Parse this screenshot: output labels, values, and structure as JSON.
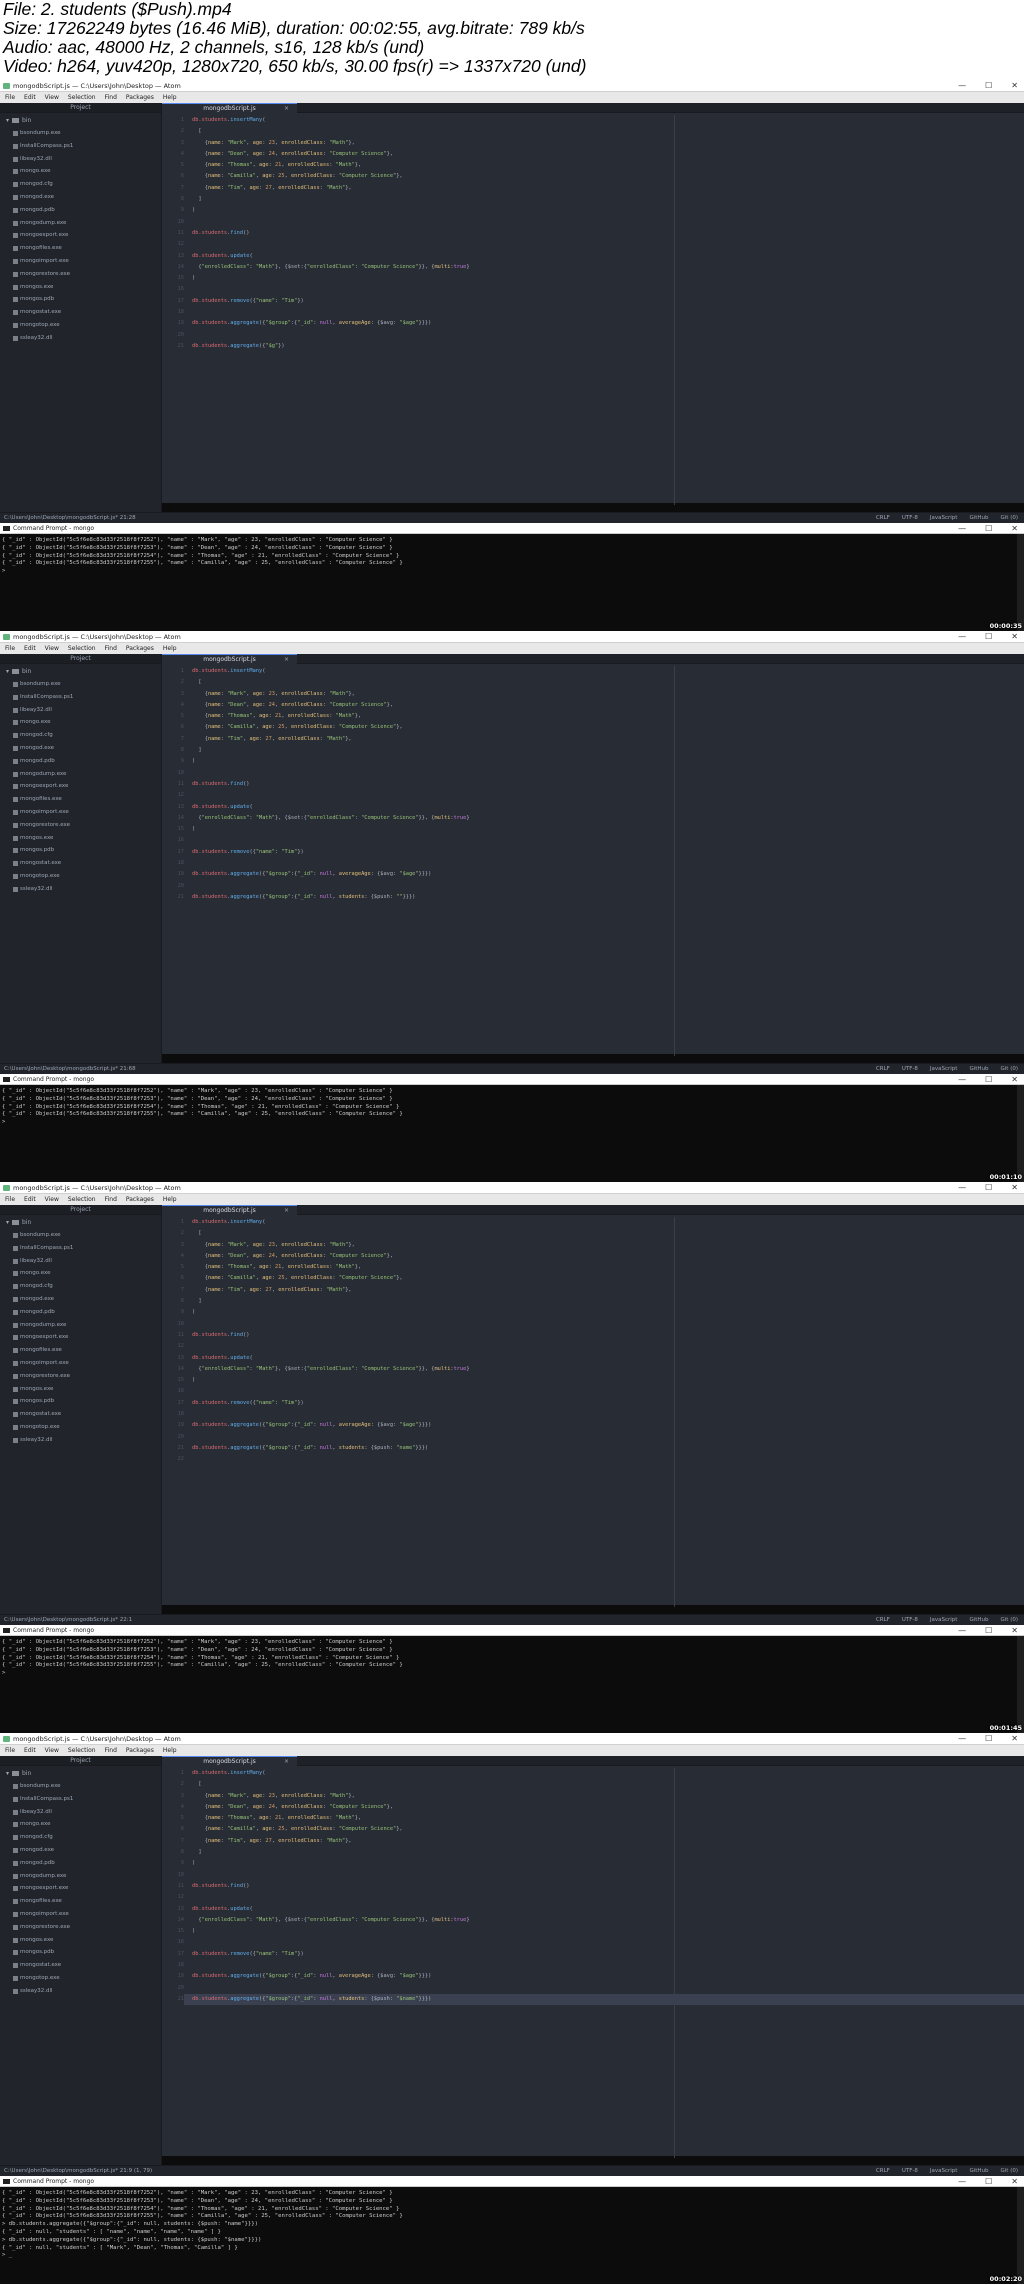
{
  "header": {
    "lines": [
      "File: 2. students ($Push).mp4",
      "Size: 17262249 bytes (16.46 MiB), duration: 00:02:55, avg.bitrate: 789 kb/s",
      "Audio: aac, 48000 Hz, 2 channels, s16, 128 kb/s (und)",
      "Video: h264, yuv420p, 1280x720, 650 kb/s, 30.00 fps(r) => 1337x720 (und)"
    ]
  },
  "app": {
    "window_title": "mongodbScript.js — C:\\Users\\John\\Desktop — Atom",
    "menus": [
      "File",
      "Edit",
      "View",
      "Selection",
      "Find",
      "Packages",
      "Help"
    ],
    "project_label": "Project",
    "root_folder": "bin",
    "files": [
      "bsondump.exe",
      "InstallCompass.ps1",
      "libeay32.dll",
      "mongo.exe",
      "mongod.cfg",
      "mongod.exe",
      "mongod.pdb",
      "mongodump.exe",
      "mongoexport.exe",
      "mongofiles.exe",
      "mongoimport.exe",
      "mongorestore.exe",
      "mongos.exe",
      "mongos.pdb",
      "mongostat.exe",
      "mongotop.exe",
      "ssleay32.dll"
    ],
    "tab_label": "mongodbScript.js",
    "tab_close": "×",
    "status_right": [
      "CRLF",
      "UTF-8",
      "JavaScript",
      "GitHub",
      "Git (0)"
    ],
    "cmd_title": "Command Prompt - mongo",
    "window_buttons": [
      "—",
      "☐",
      "✕"
    ]
  },
  "frames": [
    {
      "status_left": "C:\\Users\\John\\Desktop\\mongodbScript.js*  21:28",
      "timestamp": "00:00:35",
      "line_count": 21,
      "highlight_line": 0
    },
    {
      "status_left": "C:\\Users\\John\\Desktop\\mongodbScript.js*  21:68",
      "timestamp": "00:01:10",
      "line_count": 21,
      "highlight_line": 0
    },
    {
      "status_left": "C:\\Users\\John\\Desktop\\mongodbScript.js*  22:1",
      "timestamp": "00:01:45",
      "line_count": 22,
      "highlight_line": 0
    },
    {
      "status_left": "C:\\Users\\John\\Desktop\\mongodbScript.js*  21:9  (1, 79)",
      "timestamp": "00:02:20",
      "line_count": 21,
      "highlight_line": 21
    }
  ],
  "code_common": [
    "db.students.insertMany(",
    "  [",
    "    {name: \"Mark\", age: 23, enrolledClass: \"Math\"},",
    "    {name: \"Dean\", age: 24, enrolledClass: \"Computer Science\"},",
    "    {name: \"Thomas\", age: 21, enrolledClass: \"Math\"},",
    "    {name: \"Camilla\", age: 25, enrolledClass: \"Computer Science\"},",
    "    {name: \"Tim\", age: 27, enrolledClass: \"Math\"},",
    "  ]",
    ")",
    "",
    "db.students.find()",
    "",
    "db.students.update(",
    "  {\"enrolledClass\": \"Math\"}, {$set:{\"enrolledClass\": \"Computer Science\"}}, {multi:true}",
    ")",
    "",
    "db.students.remove({\"name\": \"Tim\"})",
    "",
    "db.students.aggregate({\"$group\":{\"_id\": null, averageAge: {$avg: \"$age\"}}})",
    ""
  ],
  "code_last": [
    "db.students.aggregate({\"$g\"})",
    "db.students.aggregate({\"$group\":{\"_id\": null, students: {$push: \"\"}}})",
    "db.students.aggregate({\"$group\":{\"_id\": null, students: {$push: \"name\"}}})",
    "db.students.aggregate({\"$group\":{\"_id\": null, students: {$push: \"$name\"}}})"
  ],
  "console_base": [
    "{ \"_id\" : ObjectId(\"5c5f6e8c83d33f2518f8f7252\"), \"name\" : \"Mark\", \"age\" : 23, \"enrolledClass\" : \"Computer Science\" }",
    "{ \"_id\" : ObjectId(\"5c5f6e8c83d33f2518f8f7253\"), \"name\" : \"Dean\", \"age\" : 24, \"enrolledClass\" : \"Computer Science\" }",
    "{ \"_id\" : ObjectId(\"5c5f6e8c83d33f2518f8f7254\"), \"name\" : \"Thomas\", \"age\" : 21, \"enrolledClass\" : \"Computer Science\" }",
    "{ \"_id\" : ObjectId(\"5c5f6e8c83d33f2518f8f7255\"), \"name\" : \"Camilla\", \"age\" : 25, \"enrolledClass\" : \"Computer Science\" }",
    ">"
  ],
  "console_extra": [
    "> db.students.aggregate({\"$group\":{\"_id\": null, students: {$push: \"name\"}}})",
    "{ \"_id\" : null, \"students\" : [ \"name\", \"name\", \"name\", \"name\" ] }",
    "> db.students.aggregate({\"$group\":{\"_id\": null, students: {$push: \"$name\"}}})",
    "{ \"_id\" : null, \"students\" : [ \"Mark\", \"Dean\", \"Thomas\", \"Camilla\" ] }",
    "> _"
  ]
}
